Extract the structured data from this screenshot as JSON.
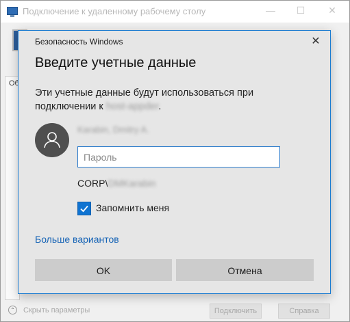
{
  "background_window": {
    "title": "Подключение к удаленному рабочему столу",
    "controls": {
      "minimize": "—",
      "maximize": "☐",
      "close": "✕"
    },
    "tab_label": "Об",
    "toggle_icon": "⌃",
    "hide_options_label": "Скрыть параметры",
    "connect_label": "Подключить",
    "help_label": "Справка"
  },
  "dialog": {
    "header": "Безопасность Windows",
    "close_glyph": "✕",
    "heading": "Введите учетные данные",
    "description_prefix": "Эти учетные данные будут использоваться при подключении к ",
    "description_host": "host-appder",
    "description_suffix": ".",
    "user_name": "Karabin, Dmitry A.",
    "password_placeholder": "Пароль",
    "password_value": "",
    "domain_prefix": "CORP\\",
    "domain_user": "DMKarabin",
    "remember_me_label": "Запомнить меня",
    "remember_me_checked": true,
    "more_options_label": "Больше вариантов",
    "ok_label": "OK",
    "cancel_label": "Отмена"
  },
  "colors": {
    "accent": "#0f73d1",
    "link": "#1563b5",
    "dialog_border": "#1a7bd0",
    "dialog_background": "#e6e6e6",
    "button_background": "#cccccc"
  },
  "icons": {
    "app": "remote-desktop-icon",
    "avatar": "user-silhouette-icon",
    "checkbox": "checkmark-icon"
  }
}
